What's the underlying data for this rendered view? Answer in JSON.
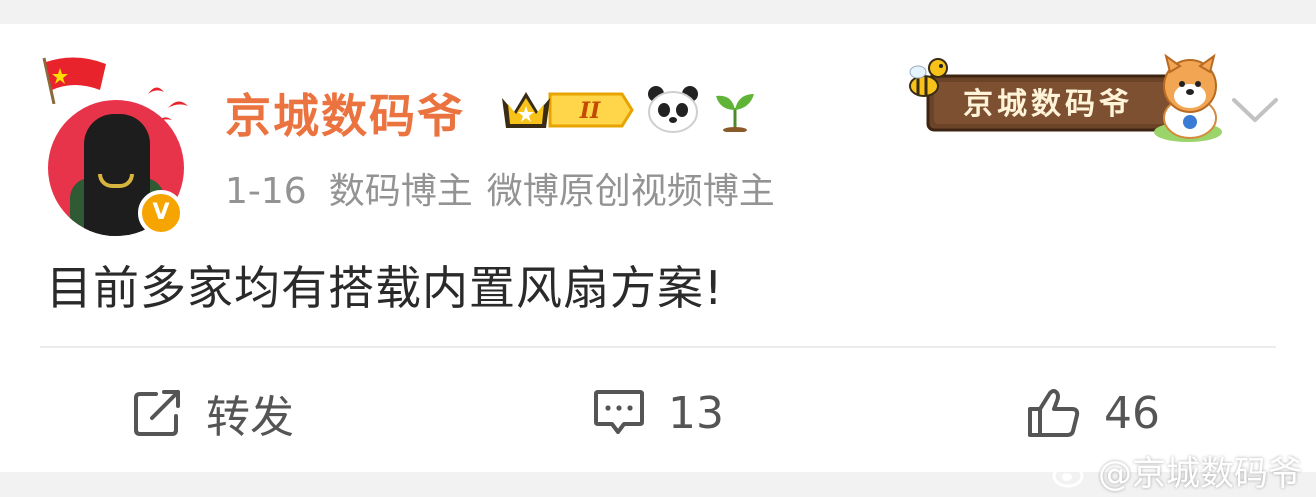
{
  "post": {
    "username": "京城数码爷",
    "level_badge": "II",
    "date": "1-16",
    "role_1": "数码博主",
    "role_2": "微博原创视频博主",
    "content": "目前多家均有搭载内置风扇方案!",
    "verified_mark": "V"
  },
  "header_sign": {
    "text": "京城数码爷"
  },
  "actions": {
    "repost_label": "转发",
    "comment_count": "13",
    "like_count": "46"
  },
  "watermark": {
    "text": "@京城数码爷"
  },
  "colors": {
    "username": "#eb7340",
    "meta": "#939393",
    "verified": "#f6a400",
    "background": "#f2f2f2"
  },
  "icons": [
    "flag-icon",
    "crown-badge-icon",
    "panda-icon",
    "sprout-icon",
    "bee-icon",
    "dog-icon",
    "chevron-down-icon",
    "repost-icon",
    "comment-icon",
    "like-icon",
    "weibo-logo-icon"
  ]
}
